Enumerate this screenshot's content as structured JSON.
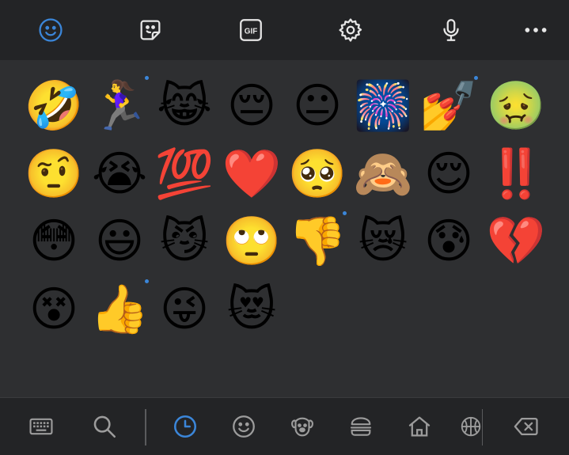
{
  "top_toolbar": {
    "tabs": [
      {
        "icon": "emoji-smiley-icon",
        "active": true
      },
      {
        "icon": "sticker-icon",
        "active": false
      },
      {
        "icon": "gif-icon",
        "label": "GIF",
        "active": false
      },
      {
        "icon": "gear-icon",
        "active": false
      },
      {
        "icon": "microphone-icon",
        "active": false
      },
      {
        "icon": "more-options-icon",
        "active": false
      }
    ]
  },
  "emoji_grid": {
    "rows": [
      [
        "🤣",
        "🏃‍♀️",
        "😹",
        "😔",
        "😐",
        "🎆",
        "💅",
        "🤢"
      ],
      [
        "🤨",
        "😭",
        "💯",
        "❤️",
        "🥺",
        "🙈",
        "😌",
        "‼️"
      ],
      [
        "😳",
        "😃",
        "😼",
        "🙄",
        "👎",
        "😿",
        "😰",
        "💔"
      ],
      [
        "😵",
        "👍",
        "😜",
        "😻"
      ]
    ],
    "has_skin_tone_variants": [
      "🏃‍♀️",
      "💅",
      "👎",
      "👍"
    ]
  },
  "bottom_toolbar": {
    "items": [
      {
        "icon": "keyboard-icon",
        "active": false
      },
      {
        "icon": "search-icon",
        "active": false
      },
      {
        "icon": "recent-clock-icon",
        "active": true
      },
      {
        "icon": "smileys-category-icon",
        "active": false
      },
      {
        "icon": "animals-category-icon",
        "active": false
      },
      {
        "icon": "food-category-icon",
        "active": false
      },
      {
        "icon": "travel-places-category-icon",
        "active": false
      },
      {
        "icon": "activities-category-icon",
        "active": false
      },
      {
        "icon": "backspace-icon",
        "active": false
      }
    ]
  },
  "colors": {
    "accent": "#3b86d9",
    "toolbar_bg": "#232426",
    "grid_bg": "#2e2f31",
    "icon_default": "#e6e6e6",
    "icon_muted": "#9c9c9c"
  }
}
